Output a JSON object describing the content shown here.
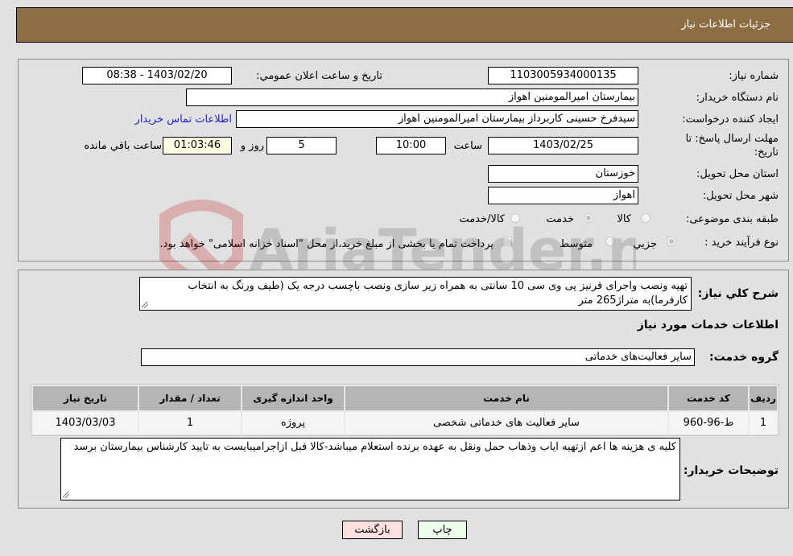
{
  "header": {
    "title": "جزئیات اطلاعات نیاز"
  },
  "fields": {
    "need_number": {
      "label": "شماره نیاز:",
      "value": "1103005934000135"
    },
    "announce_datetime": {
      "label": "تاریخ و ساعت اعلان عمومي:",
      "value": "1403/02/20 - 08:38"
    },
    "buyer_org": {
      "label": "نام دستگاه خریدار:",
      "value": "بیمارستان امیرالمومنین اهواز"
    },
    "requester": {
      "label": "ایجاد کننده درخواست:",
      "value": "سیدفرخ حسینی کاربرداز بیمارستان امیرالمومنین اهواز"
    },
    "buyer_contact_link": "اطلاعات تماس خریدار",
    "deadline": {
      "label_line1": "مهلت ارسال پاسخ: تا",
      "label_line2": "تاریخ:",
      "date": "1403/02/25",
      "time_label": "ساعت",
      "time": "10:00",
      "days": "5",
      "days_label": "روز و",
      "remaining": "01:03:46",
      "remaining_label": "ساعت باقي مانده"
    },
    "province": {
      "label": "استان محل تحویل:",
      "value": "خوزستان"
    },
    "city": {
      "label": "شهر محل تحویل:",
      "value": "اهواز"
    },
    "category": {
      "label": "طبقه بندی موضوعی:",
      "options": [
        "کالا",
        "خدمت",
        "کالا/خدمت"
      ],
      "selected": "خدمت"
    },
    "purchase_type": {
      "label": "نوع فرآیند خرید :",
      "options": [
        "جزيي",
        "متوسط"
      ],
      "selected": "جزيي",
      "treasury_note": "پرداخت تمام یا بخشی از مبلغ خرید،از محل \"اسناد خزانه اسلامی\" خواهد بود."
    }
  },
  "description": {
    "label": "شرح کلي نیاز:",
    "value": "تهیه ونصب واجرای قرنیز پی وی سی 10 سانتی به همراه زیر سازی ونصب باچسب درجه یک (طیف ورنگ به انتخاب کارفرما)به متراژ265 متر"
  },
  "services_section": {
    "title": "اطلاعات خدمات مورد نیاز",
    "group_label": "گروه خدمت:",
    "group_value": "سایر فعالیت‌های خدماتی"
  },
  "table": {
    "headers": [
      "ردیف",
      "کد خدمت",
      "نام خدمت",
      "واحد اندازه گیری",
      "تعداد / مقدار",
      "تاریخ نیاز"
    ],
    "rows": [
      [
        "1",
        "ط-96-960",
        "سایر فعالیت های خدماتی شخصی",
        "پروژه",
        "1",
        "1403/03/03"
      ]
    ]
  },
  "buyer_notes": {
    "label": "توضیحات خریدار:",
    "value": "کلیه ی هزینه ها اعم ازتهیه ایاب وذهاب حمل ونقل به عهده برنده استعلام میباشد-کالا قبل ازاجرامیبایست به تایید کارشناس بیمارستان برسد"
  },
  "buttons": {
    "print": "چاپ",
    "back": "بازگشت"
  },
  "watermark": {
    "text": "AriaTender.neT"
  }
}
